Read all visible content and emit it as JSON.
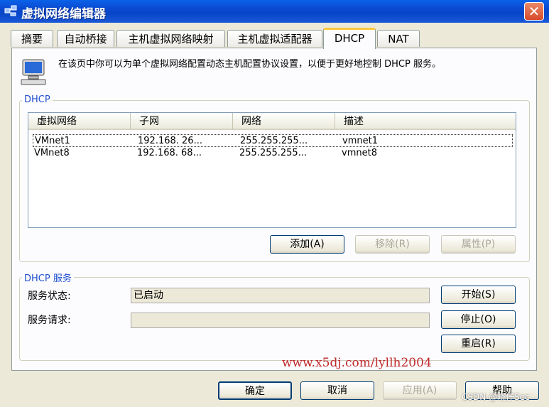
{
  "window": {
    "title": "虚拟网络编辑器",
    "close_label": "✕"
  },
  "tabs": [
    {
      "label": "摘要"
    },
    {
      "label": "自动桥接"
    },
    {
      "label": "主机虚拟网络映射"
    },
    {
      "label": "主机虚拟适配器"
    },
    {
      "label": "DHCP",
      "active": true
    },
    {
      "label": "NAT"
    }
  ],
  "description": "在该页中你可以为单个虚拟网络配置动态主机配置协议设置，以便于更好地控制 DHCP 服务。",
  "dhcp_group": {
    "legend": "DHCP",
    "columns": [
      "虚拟网络",
      "子网",
      "网络",
      "描述"
    ],
    "rows": [
      {
        "network": "VMnet1",
        "subnet": "192.168. 26...",
        "mask": "255.255.255...",
        "desc": "vmnet1"
      },
      {
        "network": "VMnet8",
        "subnet": "192.168. 68...",
        "mask": "255.255.255...",
        "desc": "vmnet8"
      }
    ],
    "buttons": {
      "add": "添加(A)",
      "remove": "移除(R)",
      "properties": "属性(P)"
    }
  },
  "service_group": {
    "legend": "DHCP 服务",
    "status_label": "服务状态:",
    "status_value": "已启动",
    "request_label": "服务请求:",
    "request_value": "",
    "buttons": {
      "start": "开始(S)",
      "stop": "停止(O)",
      "restart": "重启(R)"
    }
  },
  "footer": {
    "ok": "确定",
    "cancel": "取消",
    "apply": "应用(A)",
    "help": "帮助"
  },
  "watermark": "www.x5dj.com/lyllh2004",
  "csdn_watermark": "CSDN @晓仔Sec",
  "colors": {
    "titlebar": "#0a48d0",
    "tab_highlight": "#ffc83c",
    "legend": "#2050d0",
    "watermark": "#c0282a"
  }
}
